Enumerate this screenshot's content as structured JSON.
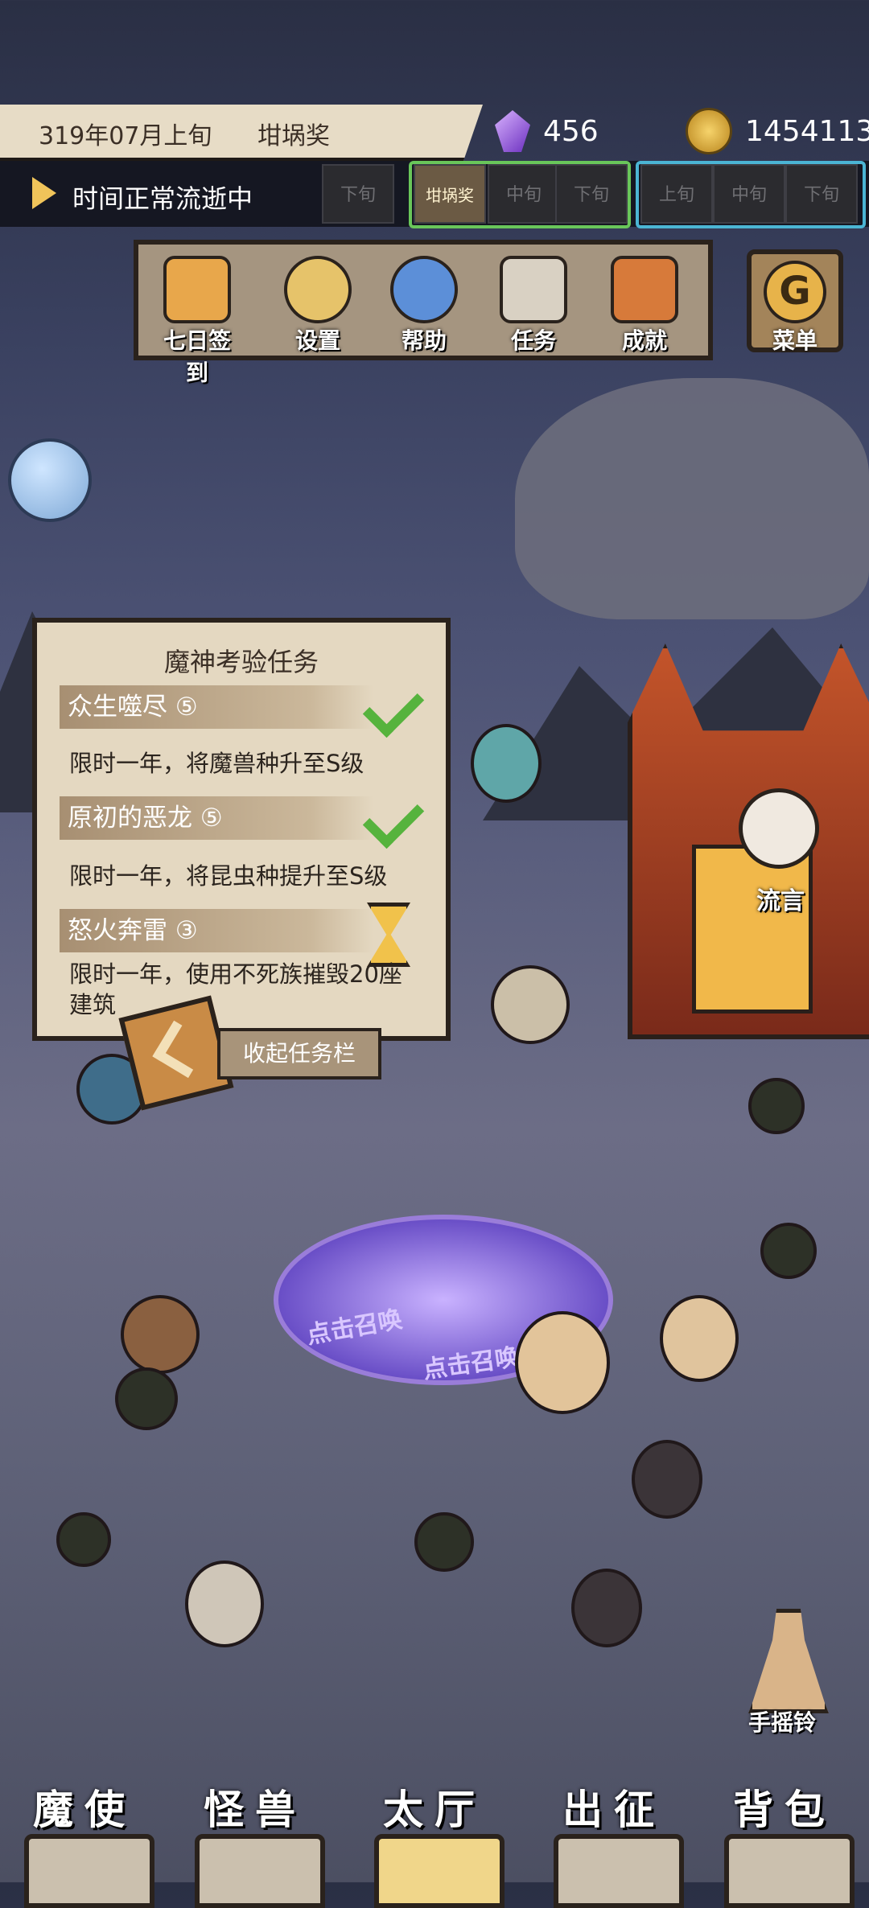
{
  "header": {
    "date": "319年07月上旬",
    "award": "坩埚奖",
    "gems": "456",
    "coins": "1454113"
  },
  "timeline": {
    "status": "时间正常流逝中",
    "slots_left": [
      "下旬"
    ],
    "slots_green": [
      "坩埚奖",
      "中旬",
      "下旬"
    ],
    "slots_blue": [
      "上旬",
      "中旬",
      "下旬"
    ],
    "colors": {
      "green": "#69c65a",
      "blue": "#4bb5d4"
    }
  },
  "menu": {
    "items": [
      {
        "label": "七日签到",
        "icon": "seven-day-signin-icon"
      },
      {
        "label": "设置",
        "icon": "gear-icon"
      },
      {
        "label": "帮助",
        "icon": "help-icon"
      },
      {
        "label": "任务",
        "icon": "quest-scroll-icon"
      },
      {
        "label": "成就",
        "icon": "trophy-icon"
      }
    ],
    "main_menu": {
      "label": "菜单",
      "glyph": "G"
    }
  },
  "tasks": {
    "title": "魔神考验任务",
    "items": [
      {
        "name": "众生噬尽 ⑤",
        "desc": "限时一年，将魔兽种升至S级",
        "status": "done"
      },
      {
        "name": "原初的恶龙 ⑤",
        "desc": "限时一年，将昆虫种提升至S级",
        "status": "done"
      },
      {
        "name": "怒火奔雷 ③",
        "desc": "限时一年，使用不死族摧毁20座建筑",
        "status": "pending"
      }
    ],
    "collapse_label": "收起任务栏"
  },
  "scene": {
    "rumor_label": "流言",
    "portal_text_1": "点击召唤",
    "portal_text_2": "点击召唤",
    "bell_label": "手摇铃"
  },
  "nav": {
    "tabs": [
      {
        "label": "魔使",
        "icon": "imp-icon"
      },
      {
        "label": "怪兽",
        "icon": "monster-icon"
      },
      {
        "label": "太厅",
        "icon": "hall-icon",
        "active": true
      },
      {
        "label": "出征",
        "icon": "expedition-icon"
      },
      {
        "label": "背包",
        "icon": "backpack-icon"
      }
    ]
  }
}
